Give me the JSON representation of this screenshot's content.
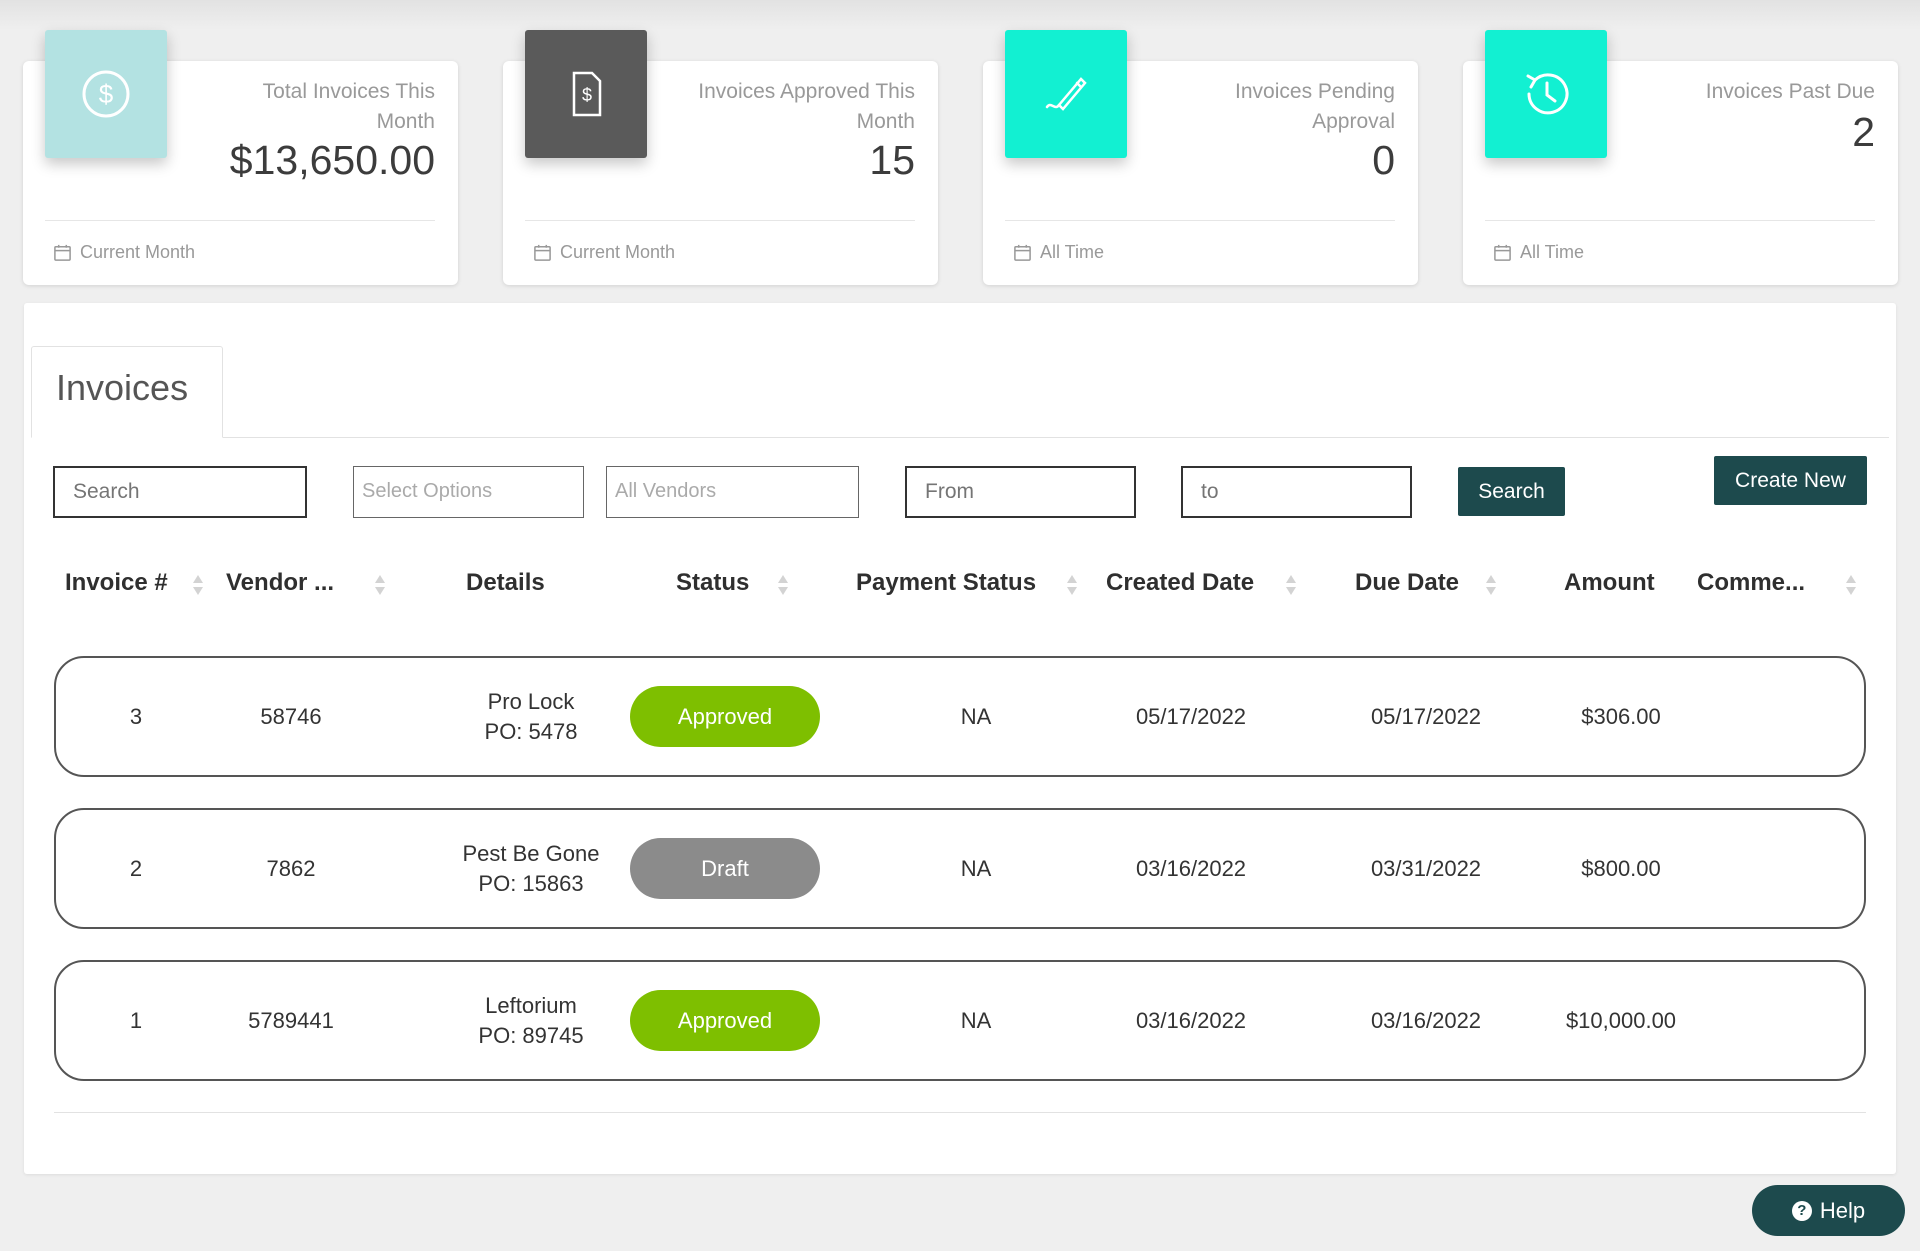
{
  "cards": [
    {
      "title": "Total Invoices This Month",
      "value": "$13,650.00",
      "footer": "Current Month",
      "icon": "dollar-circle-icon",
      "color": "#b3e2e2"
    },
    {
      "title": "Invoices Approved This Month",
      "value": "15",
      "footer": "Current Month",
      "icon": "invoice-document-icon",
      "color": "#5a5a5a"
    },
    {
      "title": "Invoices Pending Approval",
      "value": "0",
      "footer": "All Time",
      "icon": "signature-pen-icon",
      "color": "#12f0d2"
    },
    {
      "title": "Invoices Past Due",
      "value": "2",
      "footer": "All Time",
      "icon": "clock-history-icon",
      "color": "#12f0d2"
    }
  ],
  "tab": {
    "label": "Invoices"
  },
  "filters": {
    "search_placeholder": "Search",
    "status_placeholder": "Select Options",
    "vendor_placeholder": "All Vendors",
    "from_placeholder": "From",
    "to_placeholder": "to",
    "search_button": "Search",
    "create_button": "Create New"
  },
  "columns": [
    "Invoice #",
    "Vendor ...",
    "Details",
    "Status",
    "Payment Status",
    "Created Date",
    "Due Date",
    "Amount",
    "Comme..."
  ],
  "rows": [
    {
      "invoice": "3",
      "vendor": "58746",
      "details_name": "Pro Lock",
      "details_po": "PO: 5478",
      "status": "Approved",
      "payment": "NA",
      "created": "05/17/2022",
      "due": "05/17/2022",
      "amount": "$306.00",
      "comment": ""
    },
    {
      "invoice": "2",
      "vendor": "7862",
      "details_name": "Pest Be Gone",
      "details_po": "PO: 15863",
      "status": "Draft",
      "payment": "NA",
      "created": "03/16/2022",
      "due": "03/31/2022",
      "amount": "$800.00",
      "comment": ""
    },
    {
      "invoice": "1",
      "vendor": "5789441",
      "details_name": "Leftorium",
      "details_po": "PO: 89745",
      "status": "Approved",
      "payment": "NA",
      "created": "03/16/2022",
      "due": "03/16/2022",
      "amount": "$10,000.00",
      "comment": ""
    }
  ],
  "status_colors": {
    "Approved": "#7ebf00",
    "Draft": "#8b8b8b"
  },
  "help": {
    "label": "Help"
  }
}
